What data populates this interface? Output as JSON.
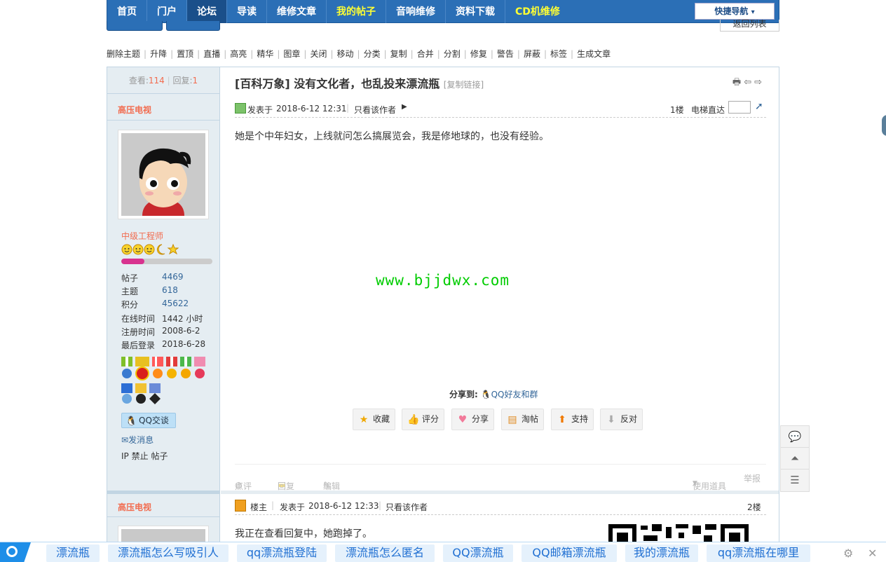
{
  "nav": {
    "items": [
      "首页",
      "门户",
      "论坛",
      "导读",
      "维修文章",
      "我的帖子",
      "音响维修",
      "资料下载",
      "CD机维修"
    ],
    "active_index": 2,
    "highlight": [
      "我的帖子",
      "CD机维修"
    ],
    "quick_nav": "快捷导航",
    "quick_nav_arrow": "▾",
    "back_list": "返回列表"
  },
  "modbar": {
    "items": [
      "删除主题",
      "升降",
      "置顶",
      "直播",
      "高亮",
      "精华",
      "图章",
      "关闭",
      "移动",
      "分类",
      "复制",
      "合并",
      "分割",
      "修复",
      "警告",
      "屏蔽",
      "标签",
      "生成文章"
    ]
  },
  "thread": {
    "views_label": "查看:",
    "views": "114",
    "replies_label": "回复:",
    "replies": "1",
    "title": "[百科万象] 没有文化者，也乱投来漂流瓶",
    "copy_link": "[复制链接]"
  },
  "author": {
    "name": "高压电视",
    "level": "中级工程师",
    "level_progress": 0.25,
    "stats": [
      {
        "label": "帖子",
        "value": "4469",
        "link": true
      },
      {
        "label": "主题",
        "value": "618",
        "link": true
      },
      {
        "label": "积分",
        "value": "45622",
        "link": true
      },
      {
        "label": "在线时间",
        "value": "1442 小时",
        "link": false
      },
      {
        "label": "注册时间",
        "value": "2008-6-2",
        "link": false
      },
      {
        "label": "最后登录",
        "value": "2018-6-28",
        "link": false
      }
    ],
    "qq_chat": "QQ交谈",
    "send_message": "发消息",
    "ip": "IP",
    "ban": "禁止",
    "posts": "帖子"
  },
  "post1": {
    "posted_prefix": "发表于",
    "posted_time": "2018-6-12 12:31",
    "only_author": "只看该作者",
    "floor": "1楼",
    "elevator": "电梯直达",
    "body": "她是个中年妇女，上线就问怎么搞展览会，我是修地球的，也没有经验。",
    "watermark": "www.bjjdwx.com",
    "share_label": "分享到:",
    "share_qq": "QQ好友和群",
    "actions": [
      "收藏",
      "评分",
      "分享",
      "淘帖",
      "支持",
      "反对"
    ],
    "bottom": {
      "comment": "点评",
      "reply": "回复",
      "edit": "编辑",
      "tools": "使用道具",
      "report": "举报"
    }
  },
  "post2": {
    "author": "高压电视",
    "owner": "楼主",
    "posted_prefix": "发表于",
    "posted_time": "2018-6-12 12:33",
    "only_author": "只看该作者",
    "floor": "2楼",
    "body": "我正在查看回复中，她跑掉了。"
  },
  "bottombar": {
    "keywords": [
      "漂流瓶",
      "漂流瓶怎么写吸引人",
      "qq漂流瓶登陆",
      "漂流瓶怎么匿名",
      "QQ漂流瓶",
      "QQ邮箱漂流瓶",
      "我的漂流瓶",
      "qq漂流瓶在哪里"
    ]
  },
  "colors": {
    "nav_bg": "#2b6fb6",
    "accent_orange": "#f26c4f",
    "link_blue": "#336699",
    "watermark_green": "#00cc00"
  }
}
